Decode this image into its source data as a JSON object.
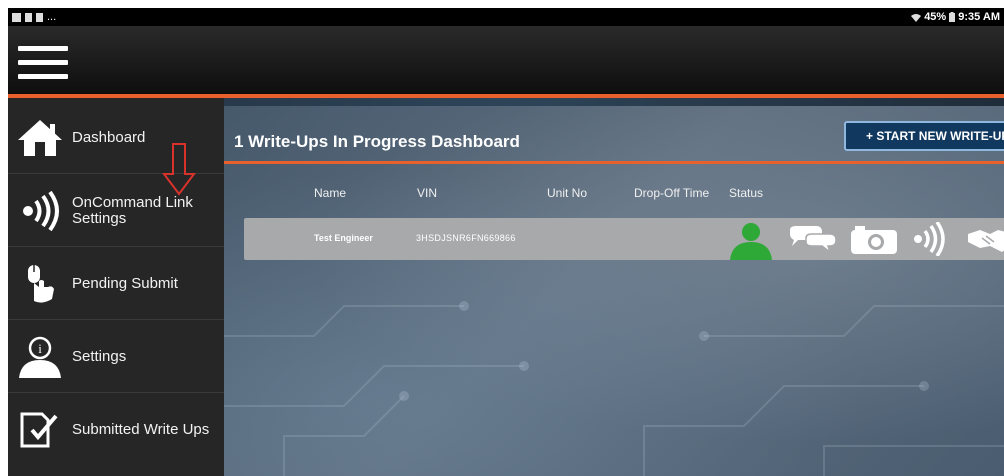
{
  "status_bar": {
    "left_text": "...",
    "battery": "45%",
    "time": "9:35 AM"
  },
  "sidebar": {
    "items": [
      {
        "label": "Dashboard",
        "icon": "home-icon"
      },
      {
        "label": "OnCommand Link Settings",
        "icon": "wireless-signal-icon"
      },
      {
        "label": "Pending Submit",
        "icon": "mouse-hand-icon"
      },
      {
        "label": "Settings",
        "icon": "user-info-icon"
      },
      {
        "label": "Submitted Write Ups",
        "icon": "document-check-icon"
      }
    ]
  },
  "dashboard": {
    "title": "1 Write-Ups In Progress Dashboard",
    "start_button": "+ START NEW WRITE-UP",
    "columns": [
      "Name",
      "VIN",
      "Unit No",
      "Drop-Off Time",
      "Status"
    ],
    "rows": [
      {
        "name": "Test Engineer",
        "vin": "3HSDJSNR6FN669866",
        "unit_no": "",
        "drop_off_time": "",
        "status_icons": [
          "user-icon",
          "chat-icon",
          "camera-icon",
          "wireless-signal-icon",
          "handshake-icon"
        ]
      }
    ]
  },
  "colors": {
    "accent": "#e8602c",
    "sidebar_bg": "#262626",
    "header_bg": "#111111",
    "button_bg": "#11385f",
    "status_user": "#2ea836",
    "annotation_arrow": "#d9322b"
  }
}
